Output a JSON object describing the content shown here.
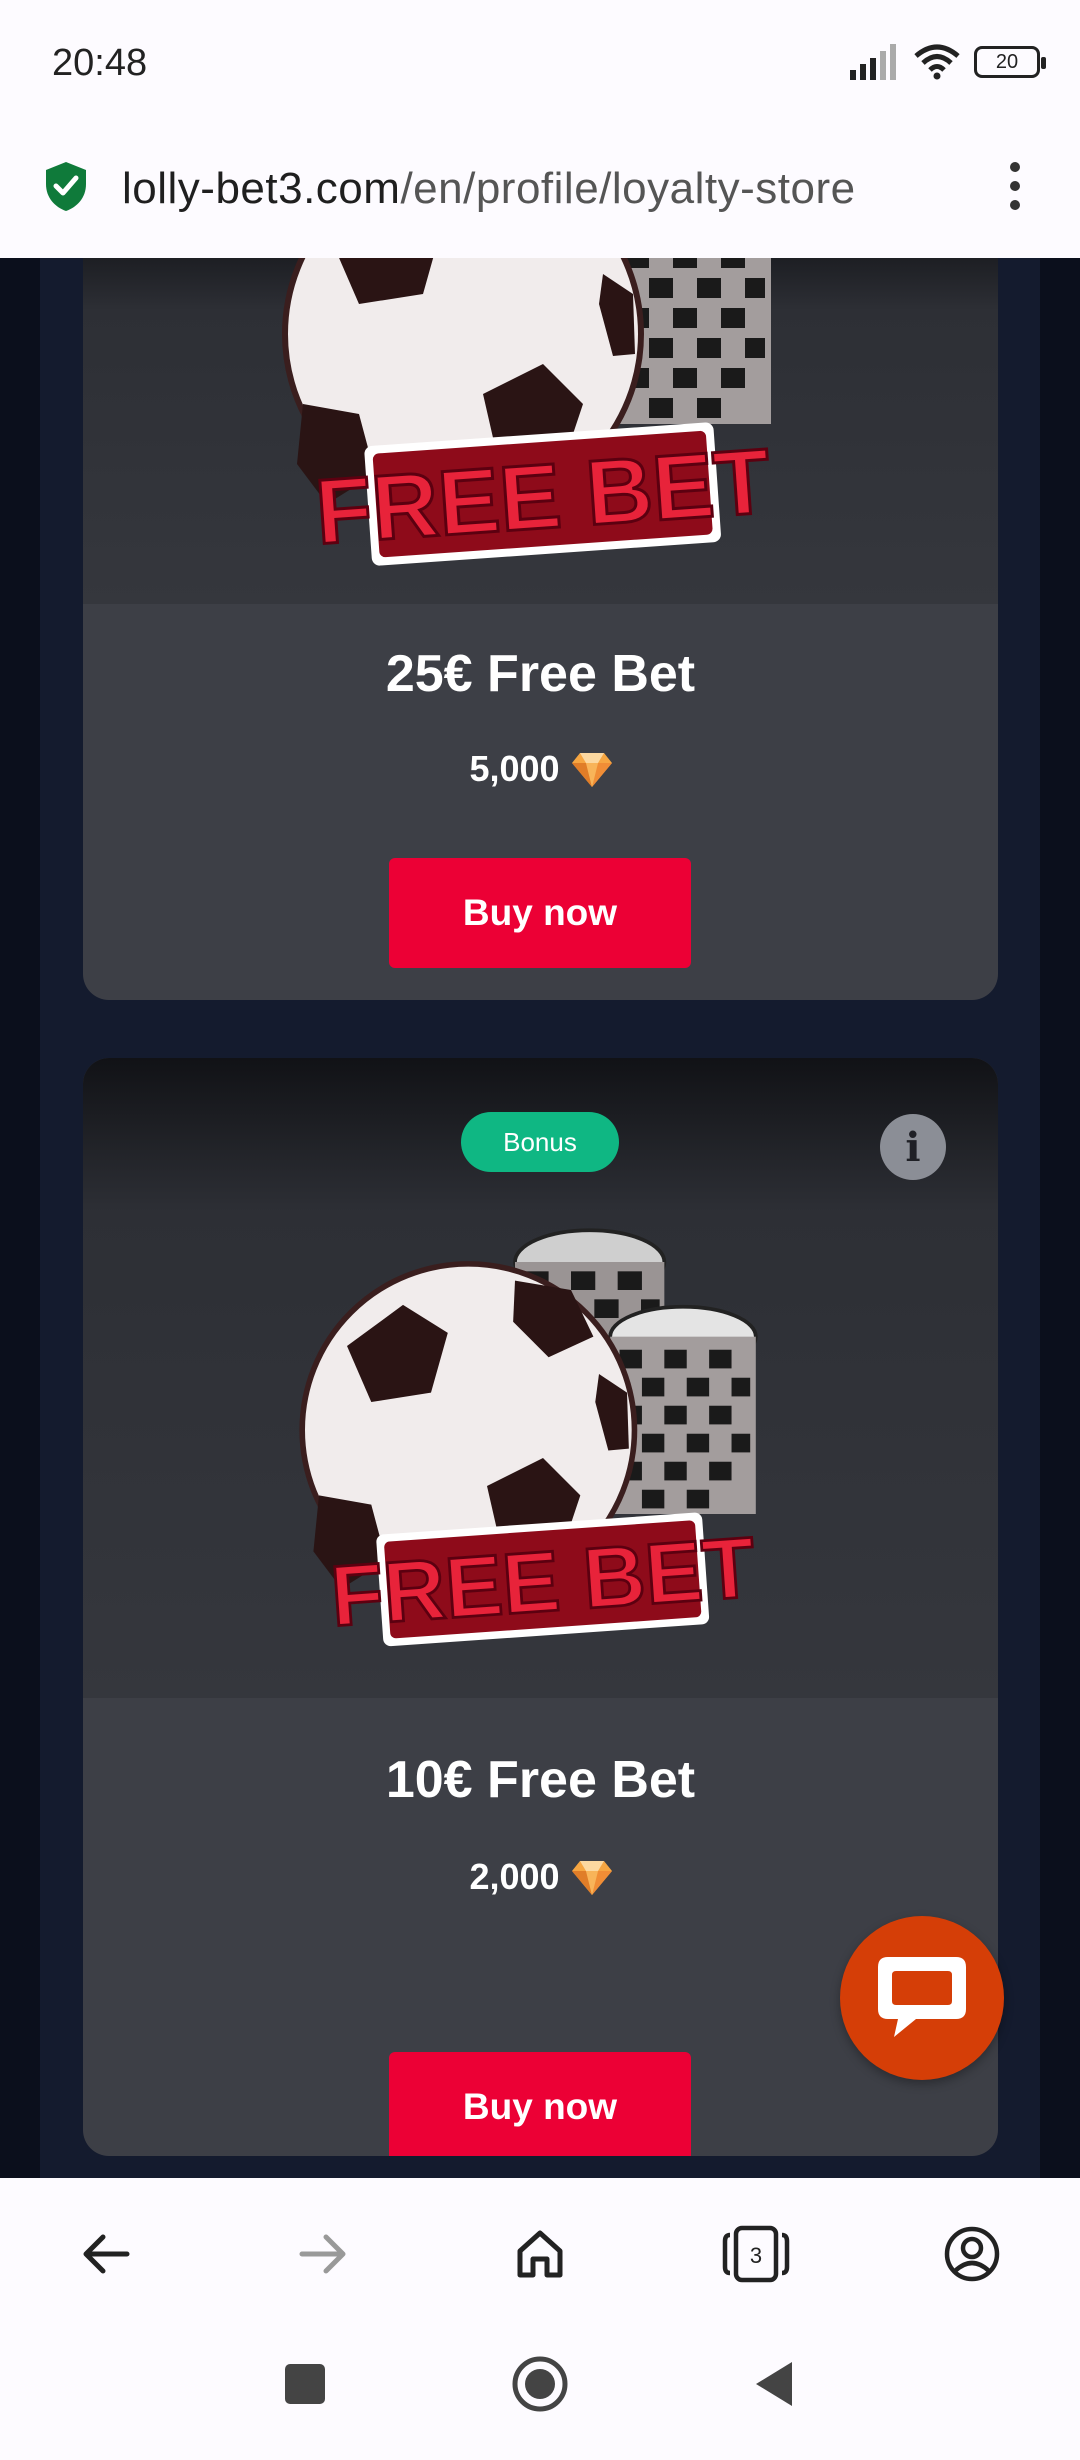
{
  "status_bar": {
    "time": "20:48",
    "battery": "20"
  },
  "address_bar": {
    "url_domain": "lolly-bet3.com",
    "url_path": "/en/profile/loyalty-store"
  },
  "cards": [
    {
      "title": "25€ Free Bet",
      "price": "5,000",
      "button_label": "Buy now",
      "image_text": "FREE BET"
    },
    {
      "badge": "Bonus",
      "title": "10€ Free Bet",
      "price": "2,000",
      "button_label": "Buy now",
      "image_text": "FREE BET"
    }
  ],
  "browser_toolbar": {
    "tabs_count": "3"
  },
  "colors": {
    "accent": "#ec0035",
    "badge": "#0fb783",
    "chat": "#d53e07",
    "card": "#3d3f46",
    "page_bg": "#141b2e"
  }
}
